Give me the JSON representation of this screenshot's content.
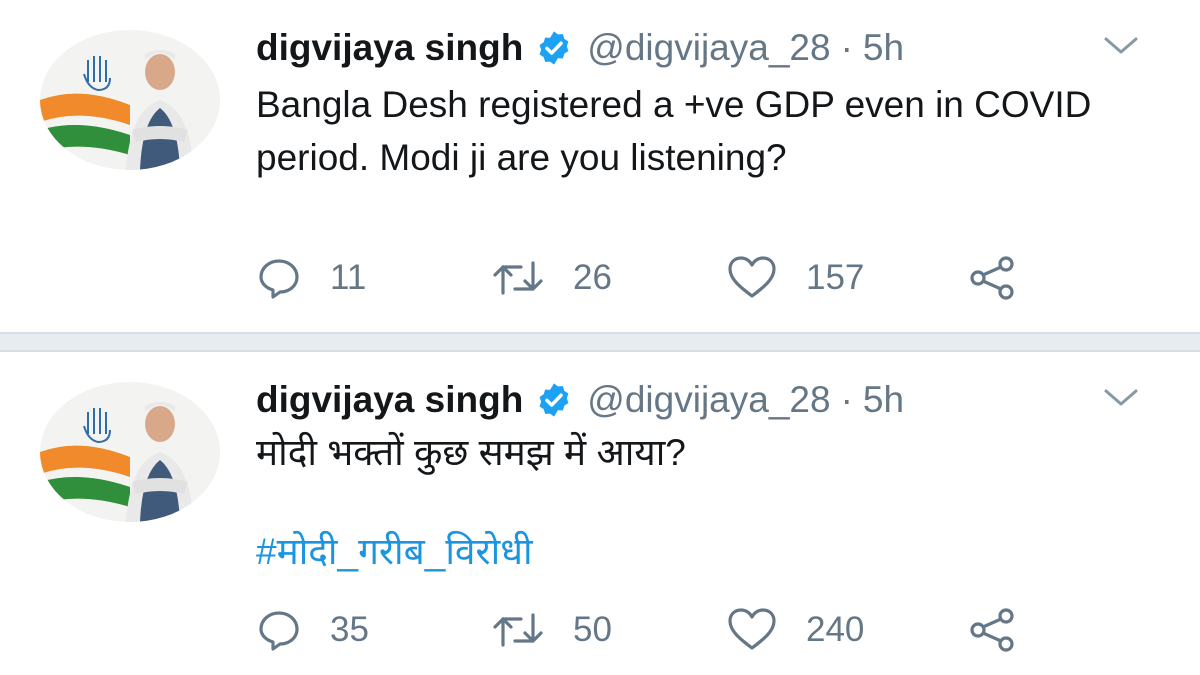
{
  "tweets": [
    {
      "name": "digvijaya singh",
      "handle": "@digvijaya_28",
      "separator": "·",
      "time": "5h",
      "text": "Bangla Desh registered a +ve GDP even in COVID period. Modi ji are you listening?",
      "hashtag": "",
      "replies": "11",
      "retweets": "26",
      "likes": "157"
    },
    {
      "name": "digvijaya singh",
      "handle": "@digvijaya_28",
      "separator": "·",
      "time": "5h",
      "text": "मोदी भक्तों कुछ समझ में आया?",
      "hashtag": "#मोदी_गरीब_विरोधी",
      "replies": "35",
      "retweets": "50",
      "likes": "240"
    }
  ],
  "icons": {
    "verified": "verified-badge-icon",
    "chevron": "chevron-down-icon",
    "reply": "reply-icon",
    "retweet": "retweet-icon",
    "like": "heart-icon",
    "share": "share-icon"
  },
  "colors": {
    "accent": "#1da1f2",
    "hashtag": "#1b95e0",
    "muted": "#657786",
    "text": "#14171a",
    "divider": "#e6ecf0"
  }
}
